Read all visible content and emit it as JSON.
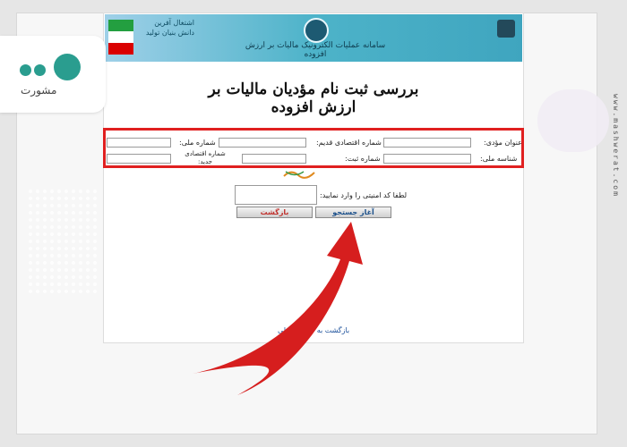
{
  "banner": {
    "title": "سامانه عملیات الکترونیک مالیات بر ارزش افزوده",
    "slogan": "اشتغال آفرین دانش بنیان تولید"
  },
  "page_title": "بررسی ثبت نام مؤدیان مالیات بر ارزش افزوده",
  "form": {
    "taxpayer_title_label": "عنوان مؤدی:",
    "old_economic_code_label": "شماره اقتصادی قدیم:",
    "national_number_label": "شماره ملی:",
    "national_id_label": "شناسه ملی:",
    "registration_number_label": "شماره ثبت:",
    "new_economic_code_label": "شماره اقتصادی جدید:"
  },
  "captcha": {
    "label": "لطفا کد امنیتی را وارد نمایید:"
  },
  "buttons": {
    "search": "آغاز جستجو",
    "back": "بازگشت"
  },
  "return_link": "بازگشت به صفحه اصلی",
  "watermark": {
    "vertical_url": "www.mashwerat.com",
    "logo_text": "مشورت"
  },
  "colors": {
    "highlight_border": "#e02020",
    "arrow": "#d61e1e"
  }
}
